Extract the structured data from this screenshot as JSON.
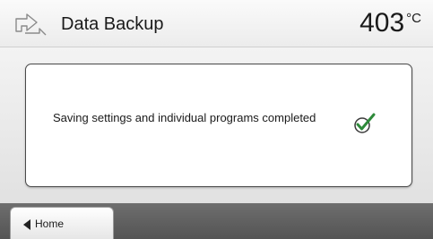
{
  "header": {
    "icon": "data-backup-icon",
    "title": "Data Backup",
    "temperature": {
      "value": "403",
      "unit": "°C"
    }
  },
  "message": {
    "text": "Saving settings and individual programs completed",
    "status_icon": "check-circle-icon",
    "status_color": "#2e8a3a"
  },
  "bottom_bar": {
    "home_label": "Home",
    "home_icon": "arrow-left-icon"
  }
}
